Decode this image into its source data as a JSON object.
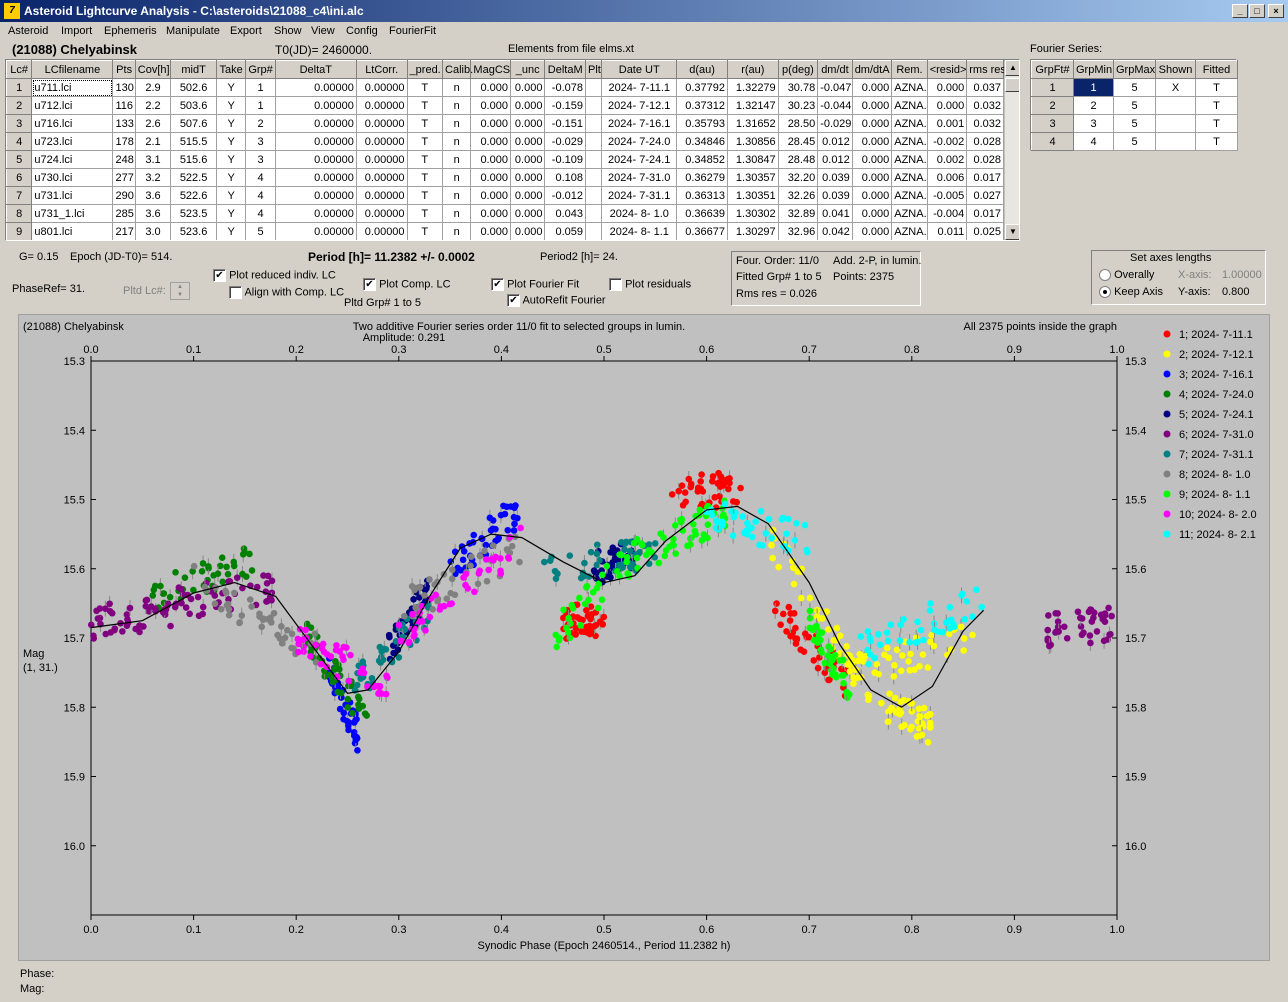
{
  "window": {
    "title": "Asteroid Lightcurve Analysis - C:\\asteroids\\21088_c4\\ini.alc"
  },
  "menu": [
    "Asteroid",
    "Import",
    "Ephemeris",
    "Manipulate",
    "Export",
    "Show",
    "View",
    "Config",
    "FourierFit"
  ],
  "header": {
    "asteroid": "(21088) Chelyabinsk",
    "t0": "T0(JD)= 2460000.",
    "elements": "Elements from file elms.xt"
  },
  "lc_table": {
    "columns": [
      "Lc#",
      "LCfilename",
      "Pts",
      "Cov[h]",
      "midT",
      "Take",
      "Grp#",
      "DeltaT",
      "LtCorr.",
      "_pred.",
      "Calib.",
      "MagCS",
      "_unc",
      "DeltaM",
      "Plt",
      "Date UT",
      "d(au)",
      "r(au)",
      "p(deg)",
      "dm/dt",
      "dm/dtA",
      "Rem.",
      "<resid>",
      "rms res"
    ],
    "rows": [
      [
        "1",
        "u711.lci",
        "130",
        "2.9",
        "502.6",
        "Y",
        "1",
        "0.00000",
        "0.00000",
        "T",
        "n",
        "0.000",
        "0.000",
        "-0.078",
        "",
        "2024- 7-11.1",
        "0.37792",
        "1.32279",
        "30.78",
        "-0.047",
        "0.000",
        "AZNA.",
        "0.000",
        "0.037"
      ],
      [
        "2",
        "u712.lci",
        "116",
        "2.2",
        "503.6",
        "Y",
        "1",
        "0.00000",
        "0.00000",
        "T",
        "n",
        "0.000",
        "0.000",
        "-0.159",
        "",
        "2024- 7-12.1",
        "0.37312",
        "1.32147",
        "30.23",
        "-0.044",
        "0.000",
        "AZNA.",
        "0.000",
        "0.032"
      ],
      [
        "3",
        "u716.lci",
        "133",
        "2.6",
        "507.6",
        "Y",
        "2",
        "0.00000",
        "0.00000",
        "T",
        "n",
        "0.000",
        "0.000",
        "-0.151",
        "",
        "2024- 7-16.1",
        "0.35793",
        "1.31652",
        "28.50",
        "-0.029",
        "0.000",
        "AZNA.",
        "0.001",
        "0.032"
      ],
      [
        "4",
        "u723.lci",
        "178",
        "2.1",
        "515.5",
        "Y",
        "3",
        "0.00000",
        "0.00000",
        "T",
        "n",
        "0.000",
        "0.000",
        "-0.029",
        "",
        "2024- 7-24.0",
        "0.34846",
        "1.30856",
        "28.45",
        "0.012",
        "0.000",
        "AZNA.",
        "-0.002",
        "0.028"
      ],
      [
        "5",
        "u724.lci",
        "248",
        "3.1",
        "515.6",
        "Y",
        "3",
        "0.00000",
        "0.00000",
        "T",
        "n",
        "0.000",
        "0.000",
        "-0.109",
        "",
        "2024- 7-24.1",
        "0.34852",
        "1.30847",
        "28.48",
        "0.012",
        "0.000",
        "AZNA.",
        "0.002",
        "0.028"
      ],
      [
        "6",
        "u730.lci",
        "277",
        "3.2",
        "522.5",
        "Y",
        "4",
        "0.00000",
        "0.00000",
        "T",
        "n",
        "0.000",
        "0.000",
        "0.108",
        "",
        "2024- 7-31.0",
        "0.36279",
        "1.30357",
        "32.20",
        "0.039",
        "0.000",
        "AZNA.",
        "0.006",
        "0.017"
      ],
      [
        "7",
        "u731.lci",
        "290",
        "3.6",
        "522.6",
        "Y",
        "4",
        "0.00000",
        "0.00000",
        "T",
        "n",
        "0.000",
        "0.000",
        "-0.012",
        "",
        "2024- 7-31.1",
        "0.36313",
        "1.30351",
        "32.26",
        "0.039",
        "0.000",
        "AZNA.",
        "-0.005",
        "0.027"
      ],
      [
        "8",
        "u731_1.lci",
        "285",
        "3.6",
        "523.5",
        "Y",
        "4",
        "0.00000",
        "0.00000",
        "T",
        "n",
        "0.000",
        "0.000",
        "0.043",
        "",
        "2024- 8- 1.0",
        "0.36639",
        "1.30302",
        "32.89",
        "0.041",
        "0.000",
        "AZNA.",
        "-0.004",
        "0.017"
      ],
      [
        "9",
        "u801.lci",
        "217",
        "3.0",
        "523.6",
        "Y",
        "5",
        "0.00000",
        "0.00000",
        "T",
        "n",
        "0.000",
        "0.000",
        "0.059",
        "",
        "2024- 8- 1.1",
        "0.36677",
        "1.30297",
        "32.96",
        "0.042",
        "0.000",
        "AZNA.",
        "0.011",
        "0.025"
      ]
    ]
  },
  "fourier_table": {
    "title": "Fourier Series:",
    "columns": [
      "GrpFt#",
      "GrpMin",
      "GrpMax",
      "Shown",
      "Fitted"
    ],
    "rows": [
      [
        "1",
        "1",
        "5",
        "X",
        "T"
      ],
      [
        "2",
        "2",
        "5",
        "",
        "T"
      ],
      [
        "3",
        "3",
        "5",
        "",
        "T"
      ],
      [
        "4",
        "4",
        "5",
        "",
        "T"
      ]
    ]
  },
  "controls": {
    "g": "G= 0.15",
    "epoch": "Epoch (JD-T0)= 514.",
    "period": "Period [h]= 11.2382 +/- 0.0002",
    "period2": "Period2 [h]= 24.",
    "phaseref": "PhaseRef= 31.",
    "pltd_lc": "Pltd Lc#:",
    "plot_reduced": "Plot reduced indiv. LC",
    "align_comp": "Align with Comp. LC",
    "plot_comp": "Plot Comp. LC",
    "pltd_grp": "Pltd Grp#  1   to   5",
    "plot_fourier": "Plot Fourier Fit",
    "autorefit": "AutoRefit Fourier",
    "plot_resid": "Plot residuals"
  },
  "fit_info": {
    "l1a": "Four. Order: 11/0",
    "l1b": "Add. 2-P, in lumin.",
    "l2a": "Fitted Grp# 1 to 5",
    "l2b": "Points: 2375",
    "l3": "Rms res     = 0.026"
  },
  "axes_box": {
    "title": "Set axes lengths",
    "overall": "Overally",
    "keep": "Keep Axis",
    "xaxis_label": "X-axis:",
    "xaxis_value": "1.00000",
    "yaxis_label": "Y-axis:",
    "yaxis_value": "0.800"
  },
  "chart_data": {
    "type": "scatter",
    "title": "Two additive Fourier series order 11/0 fit to selected groups in lumin.",
    "subtitle": "Amplitude: 0.291",
    "label_left": "(21088) Chelyabinsk",
    "label_right": "All 2375 points inside the graph",
    "xlabel": "Synodic Phase (Epoch 2460514., Period 11.2382 h)",
    "ylabel": "Mag",
    "ylabel2": "(1, 31.)",
    "xlim": [
      0,
      1
    ],
    "ylim": [
      15.3,
      16.1
    ],
    "y_inverted": true,
    "xticks": [
      "0.0",
      "0.1",
      "0.2",
      "0.3",
      "0.4",
      "0.5",
      "0.6",
      "0.7",
      "0.8",
      "0.9",
      "1.0"
    ],
    "yticks": [
      "15.3",
      "15.4",
      "15.5",
      "15.6",
      "15.7",
      "15.8",
      "15.9",
      "16.0"
    ],
    "legend": [
      {
        "label": "1; 2024- 7-11.1",
        "color": "#ff0000"
      },
      {
        "label": "2; 2024- 7-12.1",
        "color": "#ffff00"
      },
      {
        "label": "3; 2024- 7-16.1",
        "color": "#0000ff"
      },
      {
        "label": "4; 2024- 7-24.0",
        "color": "#008000"
      },
      {
        "label": "5; 2024- 7-24.1",
        "color": "#000080"
      },
      {
        "label": "6; 2024- 7-31.0",
        "color": "#800080"
      },
      {
        "label": "7; 2024- 7-31.1",
        "color": "#008080"
      },
      {
        "label": "8; 2024- 8- 1.0",
        "color": "#808080"
      },
      {
        "label": "9; 2024- 8- 1.1",
        "color": "#00ff00"
      },
      {
        "label": "10; 2024- 8- 2.0",
        "color": "#ff00ff"
      },
      {
        "label": "11; 2024- 8- 2.1",
        "color": "#00ffff"
      }
    ],
    "fourier_curve": [
      [
        0.0,
        15.685
      ],
      [
        0.05,
        15.675
      ],
      [
        0.1,
        15.635
      ],
      [
        0.14,
        15.62
      ],
      [
        0.18,
        15.64
      ],
      [
        0.22,
        15.72
      ],
      [
        0.25,
        15.78
      ],
      [
        0.27,
        15.775
      ],
      [
        0.3,
        15.72
      ],
      [
        0.33,
        15.64
      ],
      [
        0.36,
        15.57
      ],
      [
        0.39,
        15.55
      ],
      [
        0.42,
        15.555
      ],
      [
        0.46,
        15.59
      ],
      [
        0.5,
        15.62
      ],
      [
        0.53,
        15.61
      ],
      [
        0.56,
        15.56
      ],
      [
        0.6,
        15.515
      ],
      [
        0.63,
        15.51
      ],
      [
        0.66,
        15.535
      ],
      [
        0.7,
        15.62
      ],
      [
        0.73,
        15.71
      ],
      [
        0.76,
        15.775
      ],
      [
        0.79,
        15.8
      ],
      [
        0.82,
        15.77
      ],
      [
        0.85,
        15.69
      ],
      [
        0.87,
        15.66
      ]
    ],
    "series": [
      {
        "group": 1,
        "segments": [
          [
            0.565,
            15.49
          ],
          [
            0.635,
            15.485
          ]
        ]
      },
      {
        "group": 1,
        "segments": [
          [
            0.46,
            15.68
          ],
          [
            0.5,
            15.67
          ]
        ]
      },
      {
        "group": 1,
        "segments": [
          [
            0.665,
            15.65
          ],
          [
            0.74,
            15.77
          ]
        ]
      },
      {
        "group": 2,
        "segments": [
          [
            0.66,
            15.55
          ],
          [
            0.76,
            15.78
          ]
        ]
      },
      {
        "group": 2,
        "segments": [
          [
            0.74,
            15.75
          ],
          [
            0.86,
            15.7
          ]
        ]
      },
      {
        "group": 2,
        "segments": [
          [
            0.77,
            15.8
          ],
          [
            0.82,
            15.83
          ]
        ]
      },
      {
        "group": 3,
        "segments": [
          [
            0.35,
            15.6
          ],
          [
            0.42,
            15.51
          ]
        ]
      },
      {
        "group": 3,
        "segments": [
          [
            0.23,
            15.74
          ],
          [
            0.26,
            15.84
          ]
        ]
      },
      {
        "group": 4,
        "segments": [
          [
            0.06,
            15.64
          ],
          [
            0.16,
            15.59
          ]
        ]
      },
      {
        "group": 4,
        "segments": [
          [
            0.21,
            15.7
          ],
          [
            0.27,
            15.82
          ]
        ]
      },
      {
        "group": 5,
        "segments": [
          [
            0.29,
            15.72
          ],
          [
            0.33,
            15.63
          ]
        ]
      },
      {
        "group": 5,
        "segments": [
          [
            0.49,
            15.6
          ],
          [
            0.53,
            15.58
          ]
        ]
      },
      {
        "group": 6,
        "segments": [
          [
            0.0,
            15.68
          ],
          [
            0.08,
            15.66
          ]
        ]
      },
      {
        "group": 6,
        "segments": [
          [
            0.08,
            15.65
          ],
          [
            0.18,
            15.63
          ]
        ]
      },
      {
        "group": 6,
        "segments": [
          [
            0.93,
            15.69
          ],
          [
            1.0,
            15.68
          ]
        ]
      },
      {
        "group": 7,
        "segments": [
          [
            0.25,
            15.78
          ],
          [
            0.33,
            15.66
          ]
        ]
      },
      {
        "group": 7,
        "segments": [
          [
            0.44,
            15.6
          ],
          [
            0.55,
            15.58
          ]
        ]
      },
      {
        "group": 8,
        "segments": [
          [
            0.1,
            15.62
          ],
          [
            0.22,
            15.72
          ]
        ]
      },
      {
        "group": 8,
        "segments": [
          [
            0.3,
            15.66
          ],
          [
            0.42,
            15.57
          ]
        ]
      },
      {
        "group": 9,
        "segments": [
          [
            0.45,
            15.7
          ],
          [
            0.55,
            15.55
          ]
        ]
      },
      {
        "group": 9,
        "segments": [
          [
            0.55,
            15.57
          ],
          [
            0.62,
            15.52
          ]
        ]
      },
      {
        "group": 9,
        "segments": [
          [
            0.7,
            15.68
          ],
          [
            0.74,
            15.77
          ]
        ]
      },
      {
        "group": 10,
        "segments": [
          [
            0.2,
            15.7
          ],
          [
            0.29,
            15.77
          ]
        ]
      },
      {
        "group": 10,
        "segments": [
          [
            0.3,
            15.7
          ],
          [
            0.42,
            15.56
          ]
        ]
      },
      {
        "group": 11,
        "segments": [
          [
            0.6,
            15.52
          ],
          [
            0.7,
            15.56
          ]
        ]
      },
      {
        "group": 11,
        "segments": [
          [
            0.75,
            15.72
          ],
          [
            0.87,
            15.64
          ]
        ]
      }
    ]
  },
  "status": {
    "phase": "Phase:",
    "mag": "Mag:"
  }
}
